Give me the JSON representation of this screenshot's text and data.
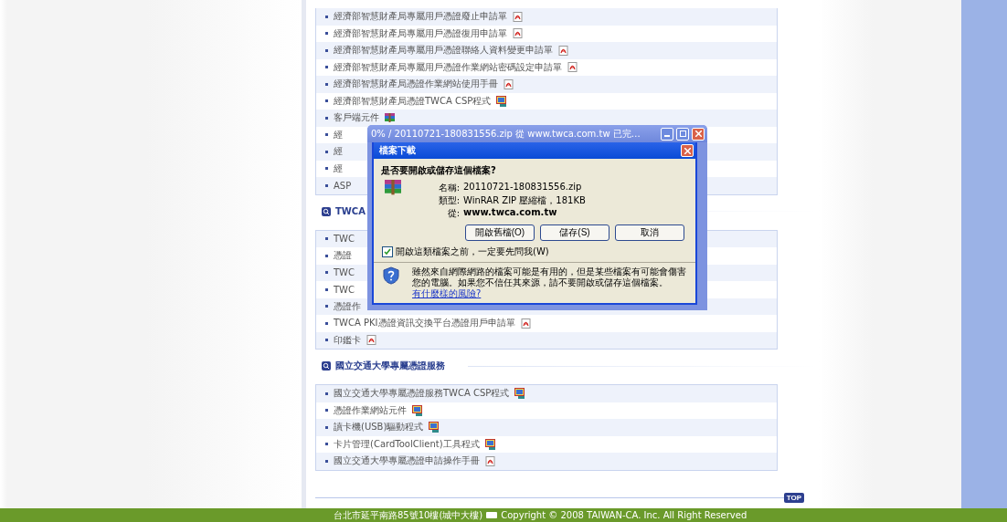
{
  "sections": [
    {
      "items": [
        {
          "text": "經濟部智慧財產局專屬用戶憑證廢止申請單",
          "kind": "pdf"
        },
        {
          "text": "經濟部智慧財產局專屬用戶憑證復用申請單",
          "kind": "pdf"
        },
        {
          "text": "經濟部智慧財產局專屬用戶憑證聯絡人資料變更申請單",
          "kind": "pdf"
        },
        {
          "text": "經濟部智慧財產局專屬用戶憑證作業網站密碼設定申請單",
          "kind": "pdf"
        },
        {
          "text": "經濟部智慧財產局憑證作業網站使用手冊",
          "kind": "pdf"
        },
        {
          "text": "經濟部智慧財產局憑證TWCA CSP程式",
          "kind": "program"
        },
        {
          "text": "客戶端元件",
          "kind": "archive"
        },
        {
          "text": "經",
          "kind": "none"
        },
        {
          "text": "經",
          "kind": "none"
        },
        {
          "text": "經",
          "kind": "none"
        },
        {
          "text": "ASP",
          "kind": "none"
        }
      ]
    },
    {
      "title": "TWCA",
      "items": [
        {
          "text": "TWC",
          "kind": "none"
        },
        {
          "text": "憑證",
          "kind": "none"
        },
        {
          "text": "TWC",
          "kind": "none"
        },
        {
          "text": "TWC",
          "kind": "none"
        },
        {
          "text": "憑證作",
          "kind": "none"
        },
        {
          "text": "TWCA PKI憑證資訊交換平台憑證用戶申請單",
          "kind": "pdf"
        },
        {
          "text": "印鑑卡",
          "kind": "pdf"
        }
      ]
    },
    {
      "title": "國立交通大學專屬憑證服務",
      "items": [
        {
          "text": "國立交通大學專屬憑證服務TWCA CSP程式",
          "kind": "program"
        },
        {
          "text": "憑證作業網站元件",
          "kind": "program"
        },
        {
          "text": "讀卡機(USB)驅動程式",
          "kind": "program"
        },
        {
          "text": "卡片管理(CardToolClient)工具程式",
          "kind": "program"
        },
        {
          "text": "國立交通大學專屬憑證申請操作手冊",
          "kind": "pdf"
        }
      ]
    }
  ],
  "top_button": "TOP",
  "footer": {
    "address": "台北市延平南路85號10樓(城中大樓)",
    "copyright": "Copyright © 2008  TAIWAN-CA. Inc. All Right Reserved"
  },
  "progress_window": {
    "title": "0% / 20110721-180831556.zip 從 www.twca.com.tw 已完…"
  },
  "dialog": {
    "title": "檔案下載",
    "question": "是否要開啟或儲存這個檔案?",
    "fields": [
      {
        "label": "名稱:",
        "value": "20110721-180831556.zip",
        "bold": false
      },
      {
        "label": "類型:",
        "value": "WinRAR ZIP 壓縮檔，181KB",
        "bold": false
      },
      {
        "label": "從:",
        "value": "www.twca.com.tw",
        "bold": true
      }
    ],
    "buttons": [
      "開啟舊檔(O)",
      "儲存(S)",
      "取消"
    ],
    "checkbox": {
      "label": "開啟這類檔案之前，一定要先問我(W)",
      "checked": true
    },
    "warning": "雖然來自網際網路的檔案可能是有用的，但是某些檔案有可能會傷害您的電腦。如果您不信任其來源，請不要開啟或儲存這個檔案。",
    "link": "有什麼樣的風險?"
  }
}
